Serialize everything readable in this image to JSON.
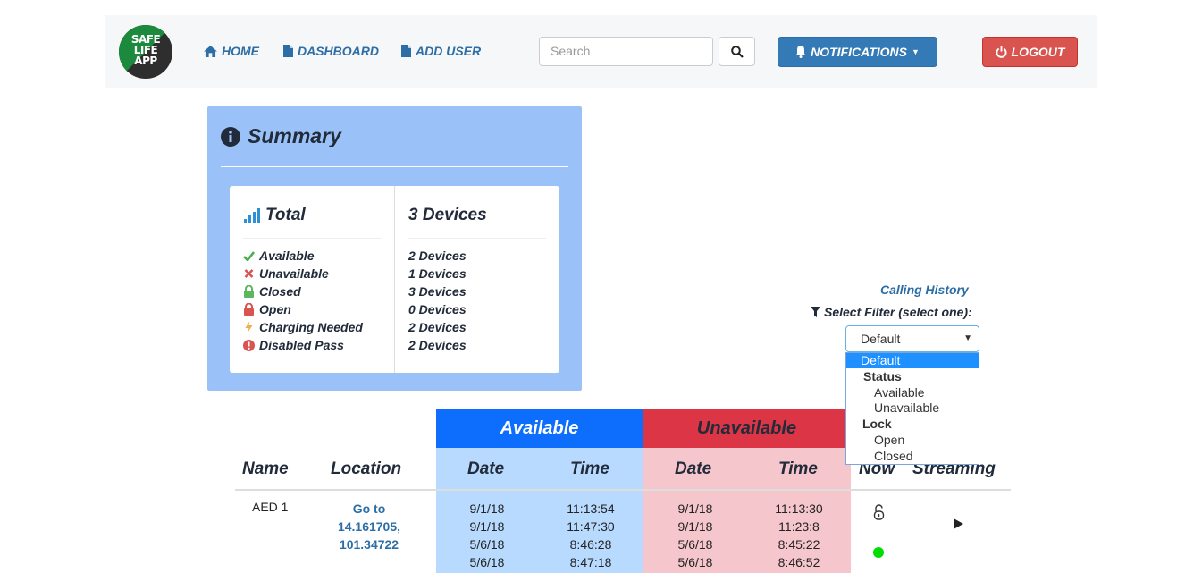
{
  "logo": {
    "line1": "SAFE",
    "line2": "LIFE",
    "line3": "APP"
  },
  "nav": {
    "home": "HOME",
    "dashboard": "DASHBOARD",
    "add_user": "ADD USER",
    "search_placeholder": "Search",
    "notifications": "NOTIFICATIONS",
    "logout": "LOGOUT"
  },
  "summary": {
    "title": "Summary",
    "total_label": "Total",
    "total_value": "3 Devices",
    "rows": [
      {
        "icon": "check-icon",
        "label": "Available",
        "value": "2 Devices",
        "color": "#4cae4c"
      },
      {
        "icon": "times-icon",
        "label": "Unavailable",
        "value": "1 Devices",
        "color": "#d9534f"
      },
      {
        "icon": "lock-closed-icon",
        "label": "Closed",
        "value": "3 Devices",
        "color": "#5cb85c"
      },
      {
        "icon": "lock-open-icon",
        "label": "Open",
        "value": "0 Devices",
        "color": "#d9534f"
      },
      {
        "icon": "bolt-icon",
        "label": "Charging Needed",
        "value": "2 Devices",
        "color": "#f0ad4e"
      },
      {
        "icon": "exclamation-circle-icon",
        "label": "Disabled Pass",
        "value": "2 Devices",
        "color": "#d9534f"
      }
    ]
  },
  "filter": {
    "calling_history": "Calling History",
    "label": "Select Filter (select one):",
    "selected": "Default",
    "options": [
      {
        "label": "Default",
        "type": "option",
        "selected": true
      },
      {
        "label": "Status",
        "type": "group"
      },
      {
        "label": "Available",
        "type": "option"
      },
      {
        "label": "Unavailable",
        "type": "option"
      },
      {
        "label": "Lock",
        "type": "group"
      },
      {
        "label": "Open",
        "type": "option"
      },
      {
        "label": "Closed",
        "type": "option"
      }
    ]
  },
  "table": {
    "band_available": "Available",
    "band_unavailable": "Unavailable",
    "headers": {
      "name": "Name",
      "location": "Location",
      "date_avail": "Date",
      "time_avail": "Time",
      "date_unavail": "Date",
      "time_unavail": "Time",
      "now": "Now",
      "streaming": "Streaming"
    },
    "rows": [
      {
        "name": "AED 1",
        "location_line1": "Go to",
        "location_line2": "14.161705,",
        "location_line3": "101.34722",
        "avail_dates": [
          "9/1/18",
          "9/1/18",
          "5/6/18",
          "5/6/18"
        ],
        "avail_times": [
          "11:13:54",
          "11:47:30",
          "8:46:28",
          "8:47:18"
        ],
        "unavail_dates": [
          "9/1/18",
          "9/1/18",
          "5/6/18",
          "5/6/18"
        ],
        "unavail_times": [
          "11:13:30",
          "11:23:8",
          "8:45:22",
          "8:46:52"
        ],
        "lock_state": "lock-open-icon",
        "status_color": "#00dd00"
      }
    ]
  },
  "colors": {
    "brand_blue": "#2d6ea6",
    "summary_bg": "#9ac2f8",
    "available": "#0d6efd",
    "unavailable": "#dc3545"
  }
}
